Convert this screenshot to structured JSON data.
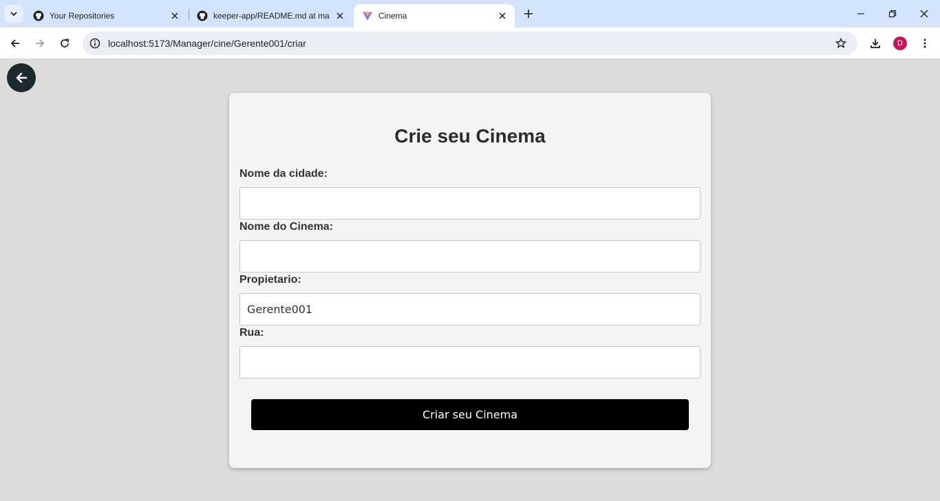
{
  "browser": {
    "tabs": [
      {
        "title": "Your Repositories",
        "icon": "github-icon",
        "active": false
      },
      {
        "title": "keeper-app/README.md at ma",
        "icon": "github-icon",
        "active": false
      },
      {
        "title": "Cinema",
        "icon": "vite-icon",
        "active": true
      }
    ],
    "url": "localhost:5173/Manager/cine/Gerente001/criar",
    "profile_initial": "D",
    "profile_color": "#c2185b"
  },
  "page": {
    "title": "Crie seu Cinema",
    "fields": [
      {
        "label": "Nome da cidade:",
        "value": "",
        "placeholder": ""
      },
      {
        "label": "Nome do Cinema:",
        "value": "",
        "placeholder": ""
      },
      {
        "label": "Propietario:",
        "value": "Gerente001",
        "placeholder": ""
      },
      {
        "label": "Rua:",
        "value": "",
        "placeholder": ""
      }
    ],
    "submit_label": "Criar seu Cinema"
  },
  "colors": {
    "page_background": "#dcdcdc",
    "card_background": "#f4f4f4",
    "button_background": "#000000",
    "back_button": "#1b2a2e"
  }
}
